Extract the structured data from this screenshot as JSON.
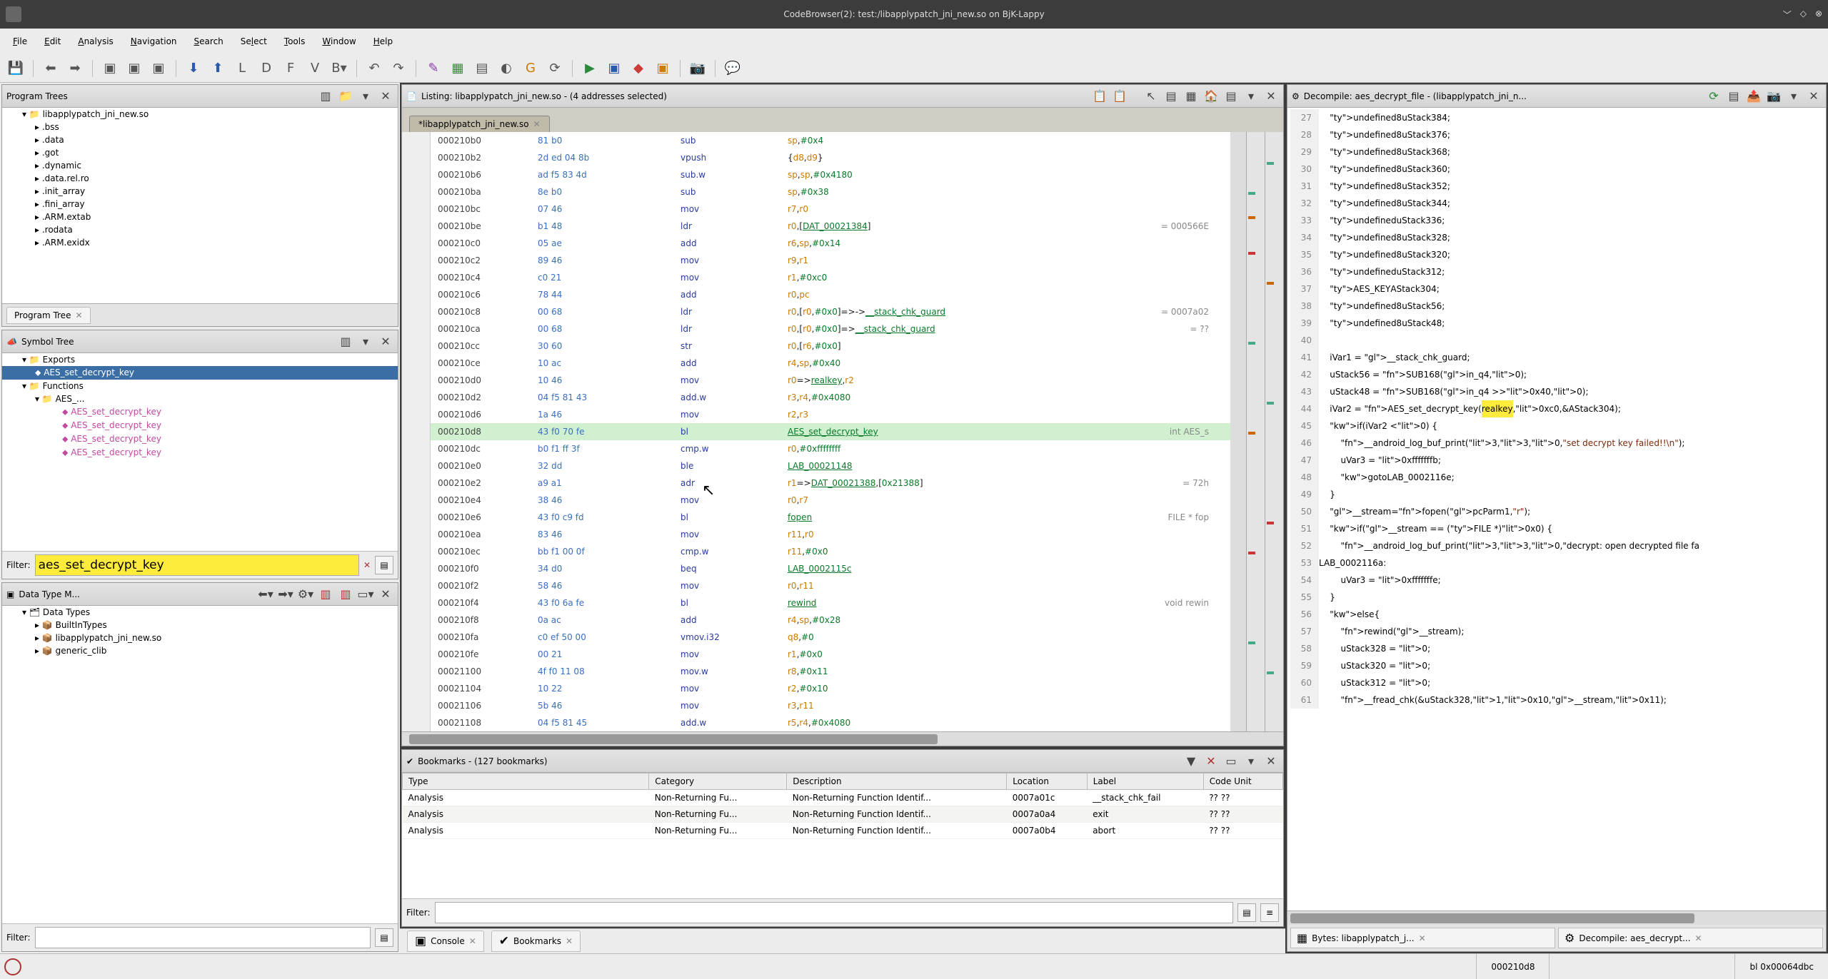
{
  "window": {
    "title": "CodeBrowser(2): test:/libapplypatch_jni_new.so on BjK-Lappy"
  },
  "menu": [
    "File",
    "Edit",
    "Analysis",
    "Navigation",
    "Search",
    "Select",
    "Tools",
    "Window",
    "Help"
  ],
  "program_trees": {
    "title": "Program Trees",
    "root": "libapplypatch_jni_new.so",
    "sections": [
      ".bss",
      ".data",
      ".got",
      ".dynamic",
      ".data.rel.ro",
      ".init_array",
      ".fini_array",
      ".ARM.extab",
      ".rodata",
      ".ARM.exidx"
    ],
    "tab": "Program Tree"
  },
  "symbol_tree": {
    "title": "Symbol Tree",
    "exports": "Exports",
    "export_item": "AES_set_decrypt_key",
    "functions": "Functions",
    "fn_group": "AES_...",
    "fn_items": [
      "AES_set_decrypt_key",
      "AES_set_decrypt_key",
      "AES_set_decrypt_key",
      "AES_set_decrypt_key"
    ],
    "filter_label": "Filter:",
    "filter_value": "aes_set_decrypt_key"
  },
  "dtm": {
    "title": "Data Type M...",
    "root": "Data Types",
    "items": [
      "BuiltInTypes",
      "libapplypatch_jni_new.so",
      "generic_clib"
    ],
    "filter_label": "Filter:"
  },
  "listing": {
    "title": "Listing: libapplypatch_jni_new.so - (4 addresses selected)",
    "tab": "*libapplypatch_jni_new.so",
    "rows": [
      {
        "a": "000210b0",
        "b": "81 b0",
        "o": "sub",
        "r": "sp,#0x4"
      },
      {
        "a": "000210b2",
        "b": "2d ed 04 8b",
        "o": "vpush",
        "r": "{d8,d9}"
      },
      {
        "a": "000210b6",
        "b": "ad f5 83 4d",
        "o": "sub.w",
        "r": "sp,sp,#0x4180"
      },
      {
        "a": "000210ba",
        "b": "8e b0",
        "o": "sub",
        "r": "sp,#0x38"
      },
      {
        "a": "000210bc",
        "b": "07 46",
        "o": "mov",
        "r": "r7,r0"
      },
      {
        "a": "000210be",
        "b": "b1 48",
        "o": "ldr",
        "r": "r0,[DAT_00021384]",
        "c": "= 000566E"
      },
      {
        "a": "000210c0",
        "b": "05 ae",
        "o": "add",
        "r": "r6,sp,#0x14"
      },
      {
        "a": "000210c2",
        "b": "89 46",
        "o": "mov",
        "r": "r9,r1"
      },
      {
        "a": "000210c4",
        "b": "c0 21",
        "o": "mov",
        "r": "r1,#0xc0"
      },
      {
        "a": "000210c6",
        "b": "78 44",
        "o": "add",
        "r": "r0,pc"
      },
      {
        "a": "000210c8",
        "b": "00 68",
        "o": "ldr",
        "r": "r0,[r0,#0x0]=>->__stack_chk_guard",
        "c": "= 0007a02"
      },
      {
        "a": "000210ca",
        "b": "00 68",
        "o": "ldr",
        "r": "r0,[r0,#0x0]=>__stack_chk_guard",
        "c": "= ??"
      },
      {
        "a": "000210cc",
        "b": "30 60",
        "o": "str",
        "r": "r0,[r6,#0x0]"
      },
      {
        "a": "000210ce",
        "b": "10 ac",
        "o": "add",
        "r": "r4,sp,#0x40"
      },
      {
        "a": "000210d0",
        "b": "10 46",
        "o": "mov",
        "r": "r0=>realkey,r2"
      },
      {
        "a": "000210d2",
        "b": "04 f5 81 43",
        "o": "add.w",
        "r": "r3,r4,#0x4080"
      },
      {
        "a": "000210d6",
        "b": "1a 46",
        "o": "mov",
        "r": "r2,r3"
      },
      {
        "a": "000210d8",
        "b": "43 f0 70 fe",
        "o": "bl",
        "r": "AES_set_decrypt_key",
        "c": "int AES_s",
        "hl": true
      },
      {
        "a": "000210dc",
        "b": "b0 f1 ff 3f",
        "o": "cmp.w",
        "r": "r0,#0xffffffff"
      },
      {
        "a": "000210e0",
        "b": "32 dd",
        "o": "ble",
        "r": "LAB_00021148"
      },
      {
        "a": "000210e2",
        "b": "a9 a1",
        "o": "adr",
        "r": "r1=>DAT_00021388,[0x21388]",
        "c": "= 72h"
      },
      {
        "a": "000210e4",
        "b": "38 46",
        "o": "mov",
        "r": "r0,r7"
      },
      {
        "a": "000210e6",
        "b": "43 f0 c9 fd",
        "o": "bl",
        "r": "fopen",
        "c": "FILE * fop"
      },
      {
        "a": "000210ea",
        "b": "83 46",
        "o": "mov",
        "r": "r11,r0"
      },
      {
        "a": "000210ec",
        "b": "bb f1 00 0f",
        "o": "cmp.w",
        "r": "r11,#0x0"
      },
      {
        "a": "000210f0",
        "b": "34 d0",
        "o": "beq",
        "r": "LAB_0002115c"
      },
      {
        "a": "000210f2",
        "b": "58 46",
        "o": "mov",
        "r": "r0,r11"
      },
      {
        "a": "000210f4",
        "b": "43 f0 6a fe",
        "o": "bl",
        "r": "rewind",
        "c": "void rewin"
      },
      {
        "a": "000210f8",
        "b": "0a ac",
        "o": "add",
        "r": "r4,sp,#0x28"
      },
      {
        "a": "000210fa",
        "b": "c0 ef 50 00",
        "o": "vmov.i32",
        "r": "q8,#0"
      },
      {
        "a": "000210fe",
        "b": "00 21",
        "o": "mov",
        "r": "r1,#0x0"
      },
      {
        "a": "00021100",
        "b": "4f f0 11 08",
        "o": "mov.w",
        "r": "r8,#0x11"
      },
      {
        "a": "00021104",
        "b": "10 22",
        "o": "mov",
        "r": "r2,#0x10"
      },
      {
        "a": "00021106",
        "b": "5b 46",
        "o": "mov",
        "r": "r3,r11"
      },
      {
        "a": "00021108",
        "b": "04 f5 81 45",
        "o": "add.w",
        "r": "r5,r4,#0x4080"
      }
    ]
  },
  "decompile": {
    "title": "Decompile: aes_decrypt_file  -  (libapplypatch_jni_n...",
    "lines": [
      {
        "n": 27,
        "t": "    undefined8 uStack384;"
      },
      {
        "n": 28,
        "t": "    undefined8 uStack376;"
      },
      {
        "n": 29,
        "t": "    undefined8 uStack368;"
      },
      {
        "n": 30,
        "t": "    undefined8 uStack360;"
      },
      {
        "n": 31,
        "t": "    undefined8 uStack352;"
      },
      {
        "n": 32,
        "t": "    undefined8 uStack344;"
      },
      {
        "n": 33,
        "t": "    undefined  uStack336;"
      },
      {
        "n": 34,
        "t": "    undefined8 uStack328;"
      },
      {
        "n": 35,
        "t": "    undefined8 uStack320;"
      },
      {
        "n": 36,
        "t": "    undefined  uStack312;"
      },
      {
        "n": 37,
        "t": "    AES_KEY AStack304;"
      },
      {
        "n": 38,
        "t": "    undefined8 uStack56;"
      },
      {
        "n": 39,
        "t": "    undefined8 uStack48;"
      },
      {
        "n": 40,
        "t": ""
      },
      {
        "n": 41,
        "t": "    iVar1 = __stack_chk_guard;"
      },
      {
        "n": 42,
        "t": "    uStack56 = SUB168(in_q4,0);"
      },
      {
        "n": 43,
        "t": "    uStack48 = SUB168(in_q4 >> 0x40,0);"
      },
      {
        "n": 44,
        "t": "    iVar2 = AES_set_decrypt_key(realkey,0xc0,&AStack304);",
        "hl": "realkey"
      },
      {
        "n": 45,
        "t": "    if (iVar2 < 0) {"
      },
      {
        "n": 46,
        "t": "        __android_log_buf_print(3,3,0,\"set decrypt key failed!!\\n\");"
      },
      {
        "n": 47,
        "t": "        uVar3 = 0xfffffffb;"
      },
      {
        "n": 48,
        "t": "        goto LAB_0002116e;"
      },
      {
        "n": 49,
        "t": "    }"
      },
      {
        "n": 50,
        "t": "    __stream = fopen(pcParm1,\"r\");"
      },
      {
        "n": 51,
        "t": "    if (__stream == (FILE *)0x0) {"
      },
      {
        "n": 52,
        "t": "        __android_log_buf_print(3,3,0,\"decrypt: open decrypted file fa"
      },
      {
        "n": 53,
        "t": "LAB_0002116a:"
      },
      {
        "n": 54,
        "t": "        uVar3 = 0xfffffffe;"
      },
      {
        "n": 55,
        "t": "    }"
      },
      {
        "n": 56,
        "t": "    else {"
      },
      {
        "n": 57,
        "t": "        rewind(__stream);"
      },
      {
        "n": 58,
        "t": "        uStack328 = 0;"
      },
      {
        "n": 59,
        "t": "        uStack320 = 0;"
      },
      {
        "n": 60,
        "t": "        uStack312 = 0;"
      },
      {
        "n": 61,
        "t": "        __fread_chk(&uStack328,1,0x10,__stream,0x11);"
      }
    ],
    "mtab1": "Bytes: libapplypatch_j...",
    "mtab2": "Decompile: aes_decrypt..."
  },
  "bookmarks": {
    "title": "Bookmarks - (127 bookmarks)",
    "cols": [
      "Type",
      "Category",
      "Description",
      "Location",
      "Label",
      "Code Unit"
    ],
    "rows": [
      {
        "t": "Analysis",
        "c": "Non-Returning Fu...",
        "d": "Non-Returning Function Identif...",
        "l": "0007a01c",
        "lb": "__stack_chk_fail",
        "cu": "?? ??"
      },
      {
        "t": "Analysis",
        "c": "Non-Returning Fu...",
        "d": "Non-Returning Function Identif...",
        "l": "0007a0a4",
        "lb": "exit",
        "cu": "?? ??"
      },
      {
        "t": "Analysis",
        "c": "Non-Returning Fu...",
        "d": "Non-Returning Function Identif...",
        "l": "0007a0b4",
        "lb": "abort",
        "cu": "?? ??"
      }
    ],
    "filter_label": "Filter:"
  },
  "bottom_tabs": {
    "console": "Console",
    "bookmarks": "Bookmarks"
  },
  "status": {
    "addr": "000210d8",
    "loc": "bl 0x00064dbc"
  }
}
